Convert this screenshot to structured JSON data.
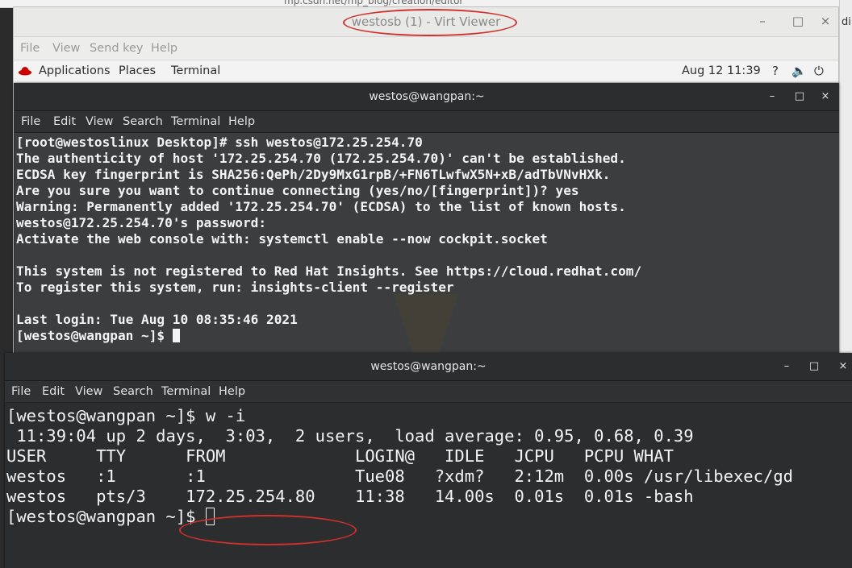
{
  "browser": {
    "url_fragment": "mp.csdn.net/mp_blog/creation/editor",
    "side_text": "din"
  },
  "virt_viewer": {
    "title": "westosb (1) - Virt Viewer",
    "menu": [
      "File",
      "View",
      "Send key",
      "Help"
    ],
    "controls": {
      "minimize": "–",
      "maximize": "□",
      "close": "×"
    }
  },
  "gnome_bar": {
    "applications": "Applications",
    "places": "Places",
    "terminal": "Terminal",
    "datetime": "Aug 12  11:39",
    "icons": [
      "help-icon",
      "volume-icon",
      "power-icon"
    ]
  },
  "term_inner": {
    "title": "westos@wangpan:~",
    "menu": [
      "File",
      "Edit",
      "View",
      "Search",
      "Terminal",
      "Help"
    ],
    "lines": [
      "[root@westoslinux Desktop]# ssh westos@172.25.254.70",
      "The authenticity of host '172.25.254.70 (172.25.254.70)' can't be established.",
      "ECDSA key fingerprint is SHA256:QePh/2Dy9MxG1rpB/+FN6TLwfwX5N+xB/adTbVNvHXk.",
      "Are you sure you want to continue connecting (yes/no/[fingerprint])? yes",
      "Warning: Permanently added '172.25.254.70' (ECDSA) to the list of known hosts.",
      "westos@172.25.254.70's password:",
      "Activate the web console with: systemctl enable --now cockpit.socket",
      "",
      "This system is not registered to Red Hat Insights. See https://cloud.redhat.com/",
      "To register this system, run: insights-client --register",
      "",
      "Last login: Tue Aug 10 08:35:46 2021"
    ],
    "prompt": "[westos@wangpan ~]$ "
  },
  "term_outer": {
    "title": "westos@wangpan:~",
    "menu": [
      "File",
      "Edit",
      "View",
      "Search",
      "Terminal",
      "Help"
    ],
    "lines": [
      "[westos@wangpan ~]$ w -i",
      " 11:39:04 up 2 days,  3:03,  2 users,  load average: 0.95, 0.68, 0.39",
      "USER     TTY      FROM             LOGIN@   IDLE   JCPU   PCPU WHAT",
      "westos   :1       :1               Tue08   ?xdm?   2:12m  0.00s /usr/libexec/gd",
      "westos   pts/3    172.25.254.80    11:38   14.00s  0.01s  0.01s -bash"
    ],
    "prompt": "[westos@wangpan ~]$ "
  }
}
